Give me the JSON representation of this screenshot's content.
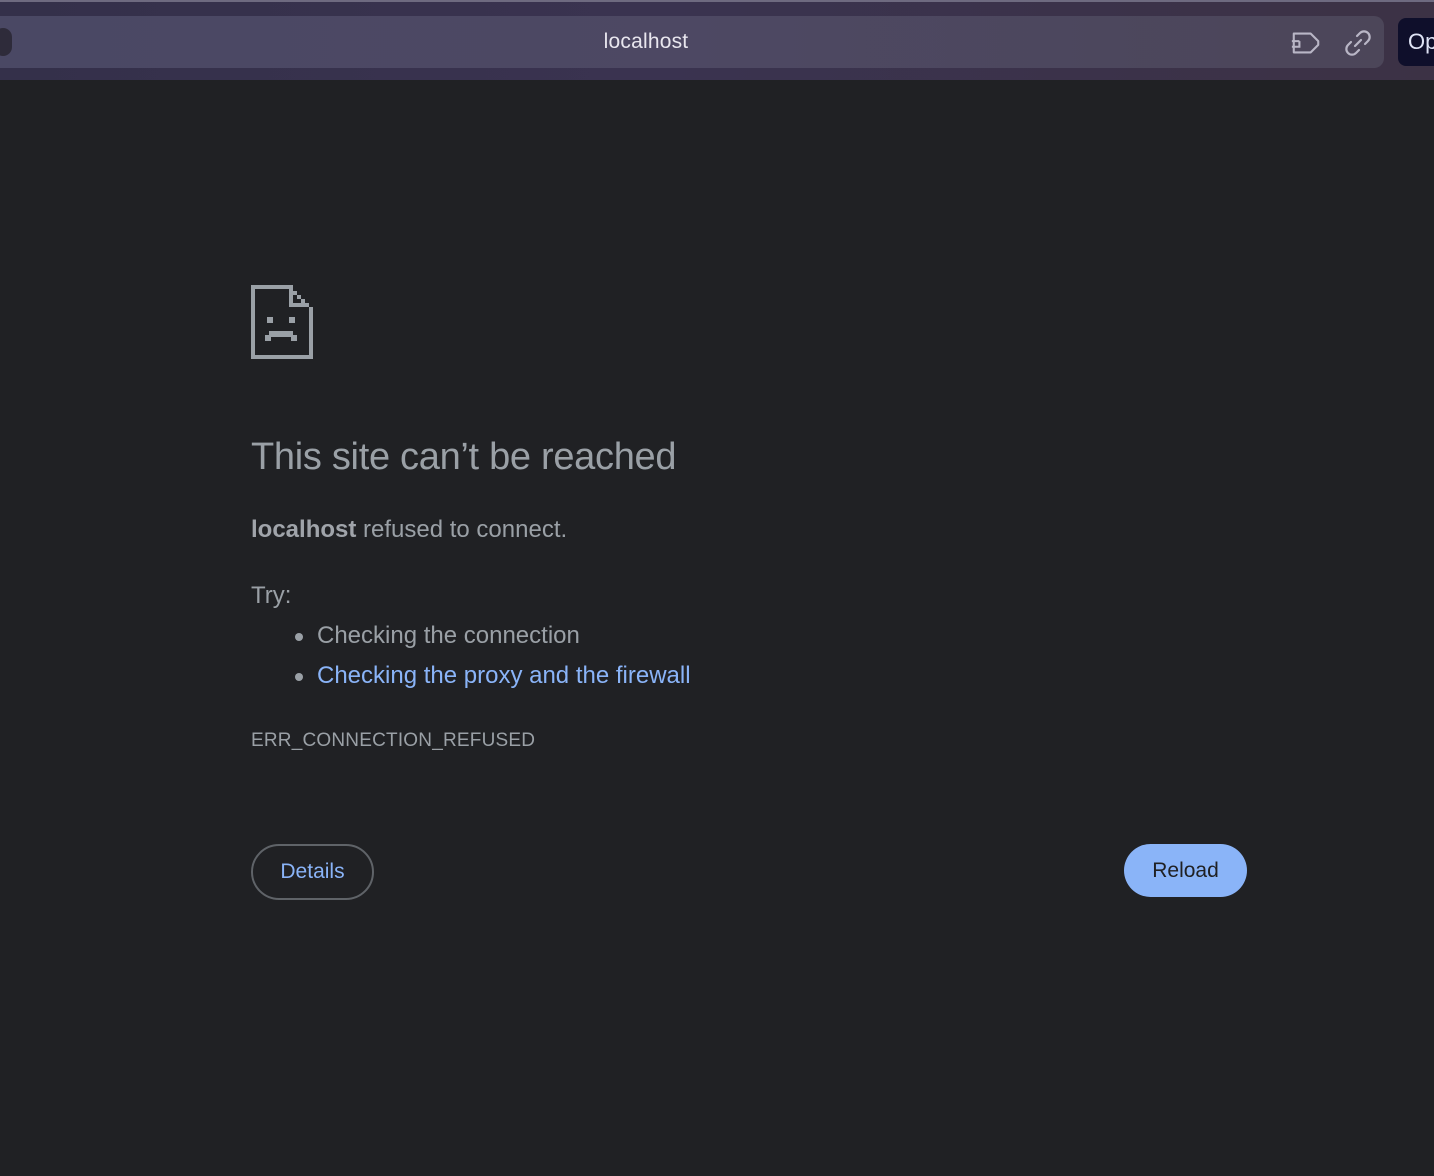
{
  "address_bar": {
    "url": "localhost",
    "open_button_label": "Op",
    "icons": [
      "extension-route-icon",
      "link-icon"
    ]
  },
  "error_page": {
    "icon": "sad-page-icon",
    "title": "This site can’t be reached",
    "host": "localhost",
    "message_suffix": "refused to connect.",
    "try_label": "Try:",
    "suggestions": [
      {
        "label": "Checking the connection",
        "is_link": false
      },
      {
        "label": "Checking the proxy and the firewall",
        "is_link": true
      }
    ],
    "error_code": "ERR_CONNECTION_REFUSED",
    "details_label": "Details",
    "reload_label": "Reload"
  },
  "colors": {
    "page_background": "#202124",
    "text": "#9aa0a6",
    "link": "#8ab4f8",
    "reload_button": "#8ab4f8"
  }
}
